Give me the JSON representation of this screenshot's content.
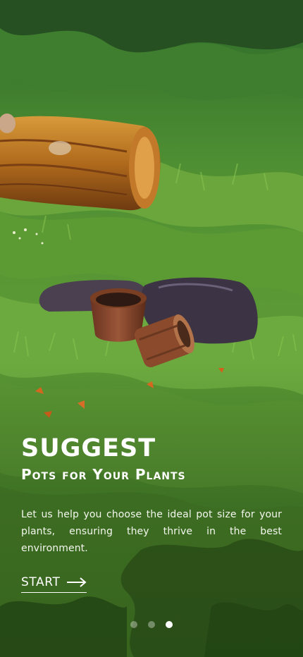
{
  "onboarding": {
    "headline": "SUGGEST",
    "subheadline": "Pots for Your Plants",
    "description": "Let us help you choose the ideal pot size for your plants, ensuring they thrive in the best environment.",
    "start_label": "START",
    "start_icon": "arrow-right-icon",
    "current_page": 3,
    "total_pages": 3
  },
  "colors": {
    "text": "#ffffff",
    "grass_dark": "#2d5a1f",
    "grass_light": "#7db046",
    "dot_inactive": "rgba(255,255,255,0.35)",
    "dot_active": "#ffffff"
  }
}
